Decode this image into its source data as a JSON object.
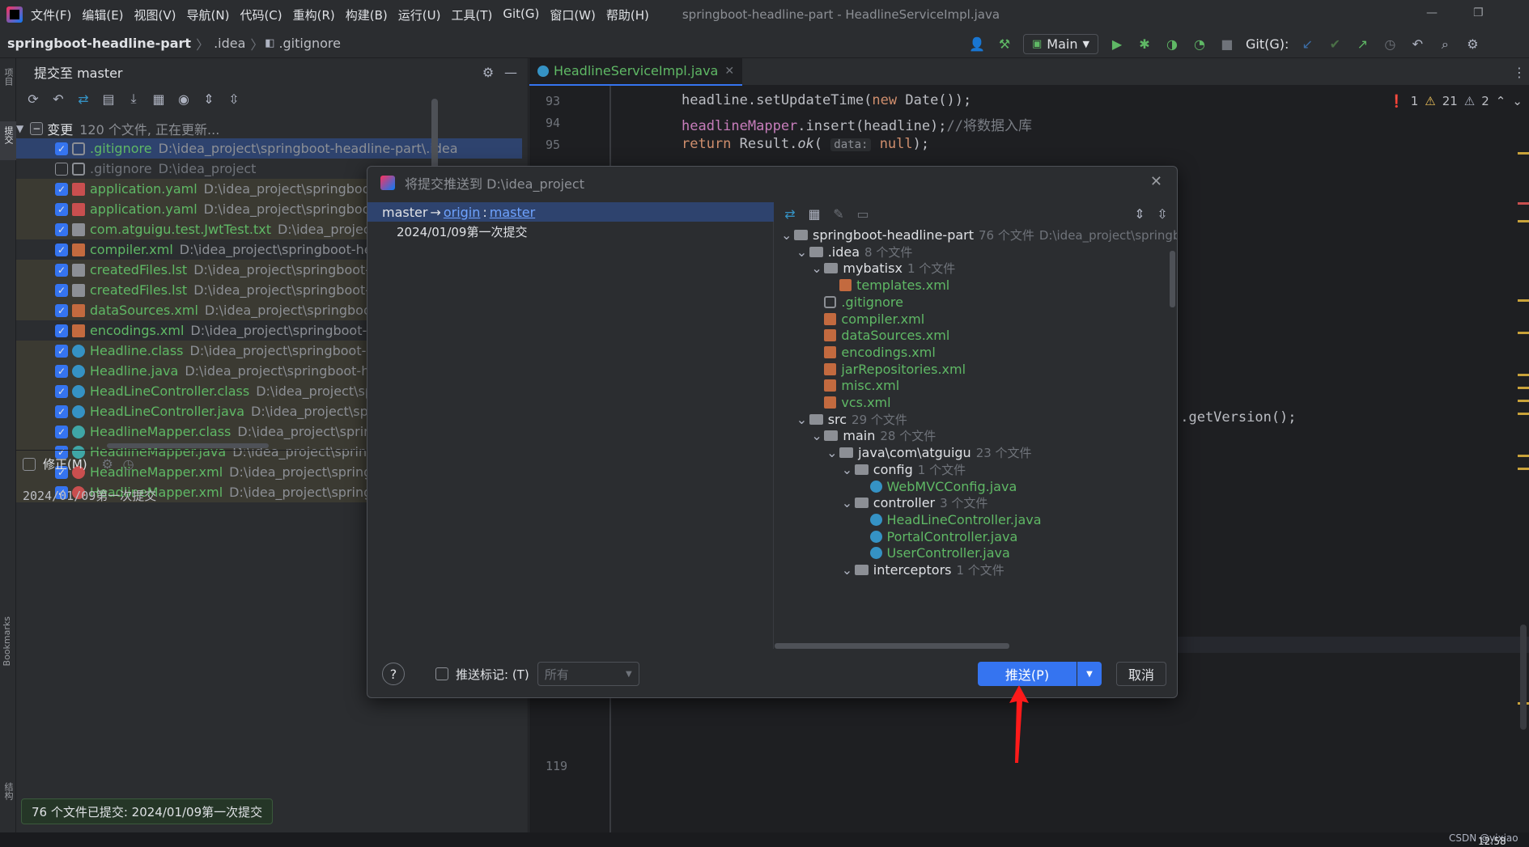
{
  "menubar": {
    "items": [
      "文件(F)",
      "编辑(E)",
      "视图(V)",
      "导航(N)",
      "代码(C)",
      "重构(R)",
      "构建(B)",
      "运行(U)",
      "工具(T)",
      "Git(G)",
      "窗口(W)",
      "帮助(H)"
    ],
    "window_title": "springboot-headline-part - HeadlineServiceImpl.java"
  },
  "navbar": {
    "project": "springboot-headline-part",
    "folder": ".idea",
    "file": ".gitignore",
    "run_config": "Main",
    "git_label": "Git(G):"
  },
  "commit_panel": {
    "title": "提交至 master",
    "changes_label": "变更",
    "changes_info": "120 个文件, 正在更新...",
    "files": [
      {
        "name": ".gitignore",
        "path": "D:\\idea_project\\springboot-headline-part\\.idea",
        "checked": true,
        "style": "green",
        "icon": "git",
        "selected": true
      },
      {
        "name": ".gitignore",
        "path": "D:\\idea_project",
        "checked": false,
        "style": "gray",
        "icon": "git"
      },
      {
        "name": "application.yaml",
        "path": "D:\\idea_project\\springboot-h",
        "checked": true,
        "style": "green",
        "icon": "yaml"
      },
      {
        "name": "application.yaml",
        "path": "D:\\idea_project\\springboot-h",
        "checked": true,
        "style": "green",
        "icon": "yaml"
      },
      {
        "name": "com.atguigu.test.JwtTest.txt",
        "path": "D:\\idea_project\\s",
        "checked": true,
        "style": "green",
        "icon": "txt"
      },
      {
        "name": "compiler.xml",
        "path": "D:\\idea_project\\springboot-head",
        "checked": true,
        "style": "green",
        "icon": "xml"
      },
      {
        "name": "createdFiles.lst",
        "path": "D:\\idea_project\\springboot-he",
        "checked": true,
        "style": "green",
        "icon": "txt"
      },
      {
        "name": "createdFiles.lst",
        "path": "D:\\idea_project\\springboot-he",
        "checked": true,
        "style": "green",
        "icon": "txt"
      },
      {
        "name": "dataSources.xml",
        "path": "D:\\idea_project\\springboot-h",
        "checked": true,
        "style": "green",
        "icon": "xml"
      },
      {
        "name": "encodings.xml",
        "path": "D:\\idea_project\\springboot-hea",
        "checked": true,
        "style": "green",
        "icon": "xml"
      },
      {
        "name": "Headline.class",
        "path": "D:\\idea_project\\springboot-hea",
        "checked": true,
        "style": "green",
        "icon": "class"
      },
      {
        "name": "Headline.java",
        "path": "D:\\idea_project\\springboot-head",
        "checked": true,
        "style": "green",
        "icon": "java"
      },
      {
        "name": "HeadLineController.class",
        "path": "D:\\idea_project\\sprin",
        "checked": true,
        "style": "green",
        "icon": "class"
      },
      {
        "name": "HeadLineController.java",
        "path": "D:\\idea_project\\spring",
        "checked": true,
        "style": "green",
        "icon": "java"
      },
      {
        "name": "HeadlineMapper.class",
        "path": "D:\\idea_project\\springb",
        "checked": true,
        "style": "green",
        "icon": "mapper"
      },
      {
        "name": "HeadlineMapper.java",
        "path": "D:\\idea_project\\springbo",
        "checked": true,
        "style": "green",
        "icon": "mapper"
      },
      {
        "name": "HeadlineMapper.xml",
        "path": "D:\\idea_project\\springbo",
        "checked": true,
        "style": "green",
        "icon": "mapperxml"
      },
      {
        "name": "HeadlineMapper.xml",
        "path": "D:\\idea_project\\springbo",
        "checked": true,
        "style": "green",
        "icon": "mapperxml"
      }
    ],
    "amend_label": "修正(M)",
    "commit_message": "2024/01/09第一次提交",
    "notification": "76 个文件已提交: 2024/01/09第一次提交"
  },
  "left_strip": {
    "project_label": "项目",
    "commit_label": "提交",
    "bookmarks_label": "Bookmarks",
    "structure_label": "结构"
  },
  "editor": {
    "tab_name": "HeadlineServiceImpl.java",
    "problems": {
      "errors": "1",
      "warnings": "21",
      "weak": "2"
    },
    "lines": [
      {
        "num": "93",
        "code": "headline.setUpdateTime(new Date());"
      },
      {
        "num": "94",
        "code": "headlineMapper.insert(headline);//将数据入库"
      },
      {
        "num": "95",
        "code": "return Result.ok( data: null);"
      }
    ],
    "partial_code": ").getVersion();",
    "line_119": "119"
  },
  "dialog": {
    "title": "将提交推送到 D:\\idea_project",
    "branch_from": "master",
    "arrow": "→",
    "remote": "origin",
    "colon": ":",
    "branch_to": "master",
    "commit_entry": "2024/01/09第一次提交",
    "tree": [
      {
        "label": "springboot-headline-part",
        "count": "76 个文件",
        "path": "D:\\idea_project\\springbo",
        "level": 0,
        "type": "folder",
        "expanded": true
      },
      {
        "label": ".idea",
        "count": "8 个文件",
        "level": 1,
        "type": "folder",
        "expanded": true
      },
      {
        "label": "mybatisx",
        "count": "1 个文件",
        "level": 2,
        "type": "folder",
        "expanded": true
      },
      {
        "label": "templates.xml",
        "level": 3,
        "type": "xml"
      },
      {
        "label": ".gitignore",
        "level": 2,
        "type": "git"
      },
      {
        "label": "compiler.xml",
        "level": 2,
        "type": "xml"
      },
      {
        "label": "dataSources.xml",
        "level": 2,
        "type": "xml"
      },
      {
        "label": "encodings.xml",
        "level": 2,
        "type": "xml"
      },
      {
        "label": "jarRepositories.xml",
        "level": 2,
        "type": "xml"
      },
      {
        "label": "misc.xml",
        "level": 2,
        "type": "xml"
      },
      {
        "label": "vcs.xml",
        "level": 2,
        "type": "xml"
      },
      {
        "label": "src",
        "count": "29 个文件",
        "level": 1,
        "type": "folder",
        "expanded": true
      },
      {
        "label": "main",
        "count": "28 个文件",
        "level": 2,
        "type": "folder",
        "expanded": true
      },
      {
        "label": "java\\com\\atguigu",
        "count": "23 个文件",
        "level": 3,
        "type": "folder",
        "expanded": true
      },
      {
        "label": "config",
        "count": "1 个文件",
        "level": 4,
        "type": "folder",
        "expanded": true
      },
      {
        "label": "WebMVCConfig.java",
        "level": 5,
        "type": "java"
      },
      {
        "label": "controller",
        "count": "3 个文件",
        "level": 4,
        "type": "folder",
        "expanded": true
      },
      {
        "label": "HeadLineController.java",
        "level": 5,
        "type": "java"
      },
      {
        "label": "PortalController.java",
        "level": 5,
        "type": "java"
      },
      {
        "label": "UserController.java",
        "level": 5,
        "type": "java"
      },
      {
        "label": "interceptors",
        "count": "1 个文件",
        "level": 4,
        "type": "folder",
        "expanded": true
      }
    ],
    "help_label": "?",
    "push_tags_label": "推送标记: (T)",
    "push_tags_value": "所有",
    "push_button": "推送(P)",
    "cancel_button": "取消"
  },
  "system": {
    "watermark": "CSDN @yixiao",
    "time": "12:58"
  },
  "colors": {
    "accent": "#3574f0",
    "added_file": "#5fb865",
    "annotation_arrow": "#ff1a1a"
  }
}
